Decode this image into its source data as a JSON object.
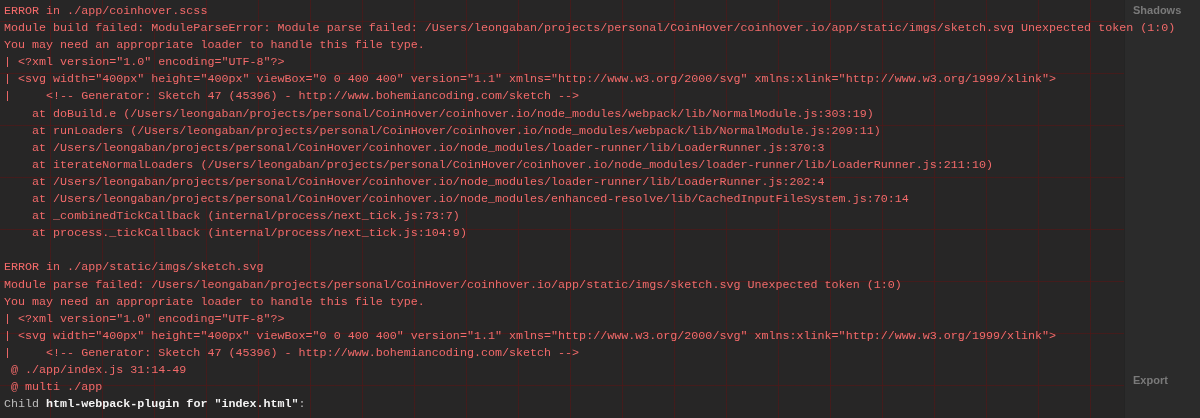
{
  "log": [
    {
      "kind": "error",
      "text": "ERROR in ./app/coinhover.scss"
    },
    {
      "kind": "error",
      "text": "Module build failed: ModuleParseError: Module parse failed: /Users/leongaban/projects/personal/CoinHover/coinhover.io/app/static/imgs/sketch.svg Unexpected token (1:0)"
    },
    {
      "kind": "error",
      "text": "You may need an appropriate loader to handle this file type."
    },
    {
      "kind": "error",
      "text": "| <?xml version=\"1.0\" encoding=\"UTF-8\"?>"
    },
    {
      "kind": "error",
      "text": "| <svg width=\"400px\" height=\"400px\" viewBox=\"0 0 400 400\" version=\"1.1\" xmlns=\"http://www.w3.org/2000/svg\" xmlns:xlink=\"http://www.w3.org/1999/xlink\">"
    },
    {
      "kind": "error",
      "text": "|     <!-- Generator: Sketch 47 (45396) - http://www.bohemiancoding.com/sketch -->"
    },
    {
      "kind": "error",
      "text": "    at doBuild.e (/Users/leongaban/projects/personal/CoinHover/coinhover.io/node_modules/webpack/lib/NormalModule.js:303:19)"
    },
    {
      "kind": "error",
      "text": "    at runLoaders (/Users/leongaban/projects/personal/CoinHover/coinhover.io/node_modules/webpack/lib/NormalModule.js:209:11)"
    },
    {
      "kind": "error",
      "text": "    at /Users/leongaban/projects/personal/CoinHover/coinhover.io/node_modules/loader-runner/lib/LoaderRunner.js:370:3"
    },
    {
      "kind": "error",
      "text": "    at iterateNormalLoaders (/Users/leongaban/projects/personal/CoinHover/coinhover.io/node_modules/loader-runner/lib/LoaderRunner.js:211:10)"
    },
    {
      "kind": "error",
      "text": "    at /Users/leongaban/projects/personal/CoinHover/coinhover.io/node_modules/loader-runner/lib/LoaderRunner.js:202:4"
    },
    {
      "kind": "error",
      "text": "    at /Users/leongaban/projects/personal/CoinHover/coinhover.io/node_modules/enhanced-resolve/lib/CachedInputFileSystem.js:70:14"
    },
    {
      "kind": "error",
      "text": "    at _combinedTickCallback (internal/process/next_tick.js:73:7)"
    },
    {
      "kind": "error",
      "text": "    at process._tickCallback (internal/process/next_tick.js:104:9)"
    },
    {
      "kind": "blank"
    },
    {
      "kind": "error",
      "text": "ERROR in ./app/static/imgs/sketch.svg"
    },
    {
      "kind": "error",
      "text": "Module parse failed: /Users/leongaban/projects/personal/CoinHover/coinhover.io/app/static/imgs/sketch.svg Unexpected token (1:0)"
    },
    {
      "kind": "error",
      "text": "You may need an appropriate loader to handle this file type."
    },
    {
      "kind": "error",
      "text": "| <?xml version=\"1.0\" encoding=\"UTF-8\"?>"
    },
    {
      "kind": "error",
      "text": "| <svg width=\"400px\" height=\"400px\" viewBox=\"0 0 400 400\" version=\"1.1\" xmlns=\"http://www.w3.org/2000/svg\" xmlns:xlink=\"http://www.w3.org/1999/xlink\">"
    },
    {
      "kind": "error",
      "text": "|     <!-- Generator: Sketch 47 (45396) - http://www.bohemiancoding.com/sketch -->"
    },
    {
      "kind": "error",
      "text": " @ ./app/index.js 31:14-49"
    },
    {
      "kind": "error",
      "text": " @ multi ./app"
    },
    {
      "kind": "info",
      "text": "Child **html-webpack-plugin for \"index.html\"**:"
    }
  ],
  "side_panel": {
    "sections": [
      "Shadows",
      "Export"
    ]
  }
}
